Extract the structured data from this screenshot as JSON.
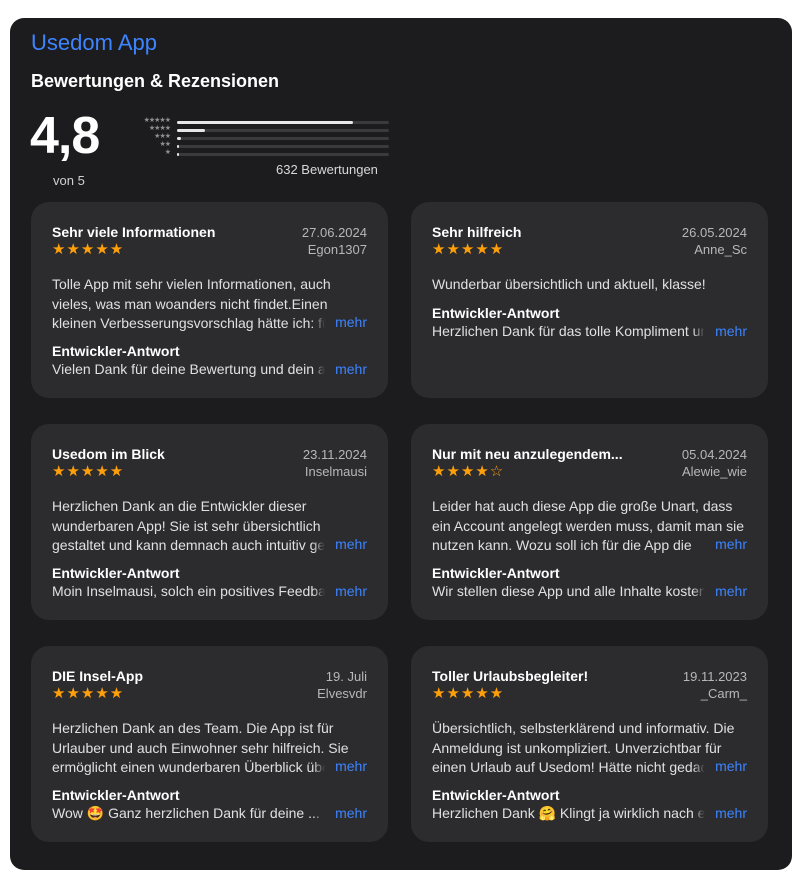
{
  "app_title": "Usedom App",
  "section_title": "Bewertungen & Rezensionen",
  "summary": {
    "rating": "4,8",
    "out_of": "von 5",
    "count_text": "632 Bewertungen",
    "distribution": [
      {
        "stars": "★★★★★",
        "fraction": 0.83
      },
      {
        "stars": "★★★★",
        "fraction": 0.13
      },
      {
        "stars": "★★★",
        "fraction": 0.02
      },
      {
        "stars": "★★",
        "fraction": 0.01
      },
      {
        "stars": "★",
        "fraction": 0.01
      }
    ]
  },
  "more_label": "mehr",
  "dev_response_title": "Entwickler-Antwort",
  "reviews": [
    {
      "title": "Sehr viele Informationen",
      "date": "27.06.2024",
      "author": "Egon1307",
      "stars": "★★★★★",
      "rating": 5,
      "body": "Tolle App mit sehr vielen Informationen, auch vieles, was man woanders nicht findet.Einen kleinen Verbesserungsvorschlag hätte ich: für",
      "dev_response": "Vielen Dank für deine Bewertung und dein ausführliches Feedback"
    },
    {
      "title": "Sehr hilfreich",
      "date": "26.05.2024",
      "author": "Anne_Sc",
      "stars": "★★★★★",
      "rating": 5,
      "body": "Wunderbar übersichtlich und aktuell, klasse!",
      "dev_response": "Herzlichen Dank für das tolle Kompliment und"
    },
    {
      "title": "Usedom im Blick",
      "date": "23.11.2024",
      "author": "Inselmausi",
      "stars": "★★★★★",
      "rating": 5,
      "body": "Herzlichen Dank an die Entwickler dieser wunderbaren App! Sie ist sehr übersichtlich gestaltet und kann demnach auch intuitiv genutzt",
      "dev_response": "Moin Inselmausi, solch ein positives Feedback"
    },
    {
      "title": "Nur mit neu anzulegendem...",
      "date": "05.04.2024",
      "author": "Alewie_wie",
      "stars": "★★★★☆",
      "rating": 4,
      "body": "Leider hat auch diese App die große Unart, dass ein Account angelegt werden muss, damit man sie nutzen kann. Wozu soll ich für die App die",
      "dev_response": "Wir stellen diese App und alle Inhalte kostenlos"
    },
    {
      "title": "DIE Insel-App",
      "date": "19. Juli",
      "author": "Elvesvdr",
      "stars": "★★★★★",
      "rating": 5,
      "body": "Herzlichen Dank an des Team. Die App ist für Urlauber und auch Einwohner sehr hilfreich. Sie ermöglicht einen wunderbaren Überblick über",
      "dev_response": "Wow 🤩 Ganz herzlichen Dank für deine ..."
    },
    {
      "title": "Toller Urlaubsbegleiter!",
      "date": "19.11.2023",
      "author": "_Carm_",
      "stars": "★★★★★",
      "rating": 5,
      "body": "Übersichtlich, selbsterklärend und informativ. Die Anmeldung ist unkompliziert. Unverzichtbar für einen Urlaub auf Usedom! Hätte nicht gedacht",
      "dev_response": "Herzlichen Dank 🤗 Klingt ja wirklich nach einem"
    }
  ]
}
